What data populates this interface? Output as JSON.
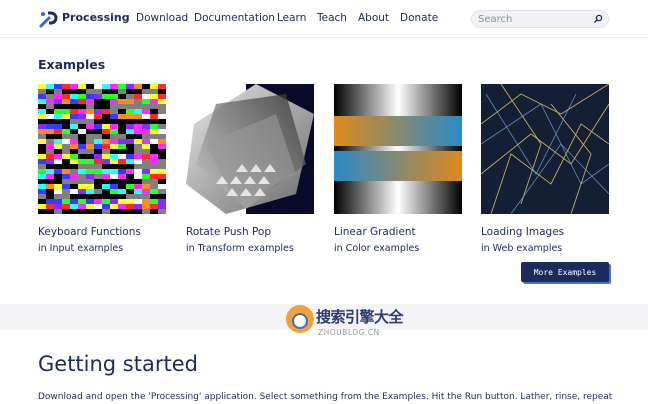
{
  "nav": {
    "brand": "Processing",
    "links": [
      "Download",
      "Documentation",
      "Learn",
      "Teach",
      "About",
      "Donate"
    ],
    "search_placeholder": "Search"
  },
  "examples": {
    "title": "Examples",
    "cards": [
      {
        "title": "Keyboard Functions",
        "subtitle": "in Input examples"
      },
      {
        "title": "Rotate Push Pop",
        "subtitle": "in Transform examples"
      },
      {
        "title": "Linear Gradient",
        "subtitle": "in Color examples"
      },
      {
        "title": "Loading Images",
        "subtitle": "in Web examples"
      }
    ],
    "more_button": "More Examples"
  },
  "watermark": {
    "text": "搜索引擎大全",
    "url": "ZHOUBLOG.CN"
  },
  "getting_started": {
    "title": "Getting started",
    "body": "Download and open the 'Processing' application. Select something from the Examples. Hit the Run button. Lather, rinse, repeat"
  },
  "colors": {
    "navy": "#1c2a5c",
    "accent_blue": "#4a70c8"
  }
}
